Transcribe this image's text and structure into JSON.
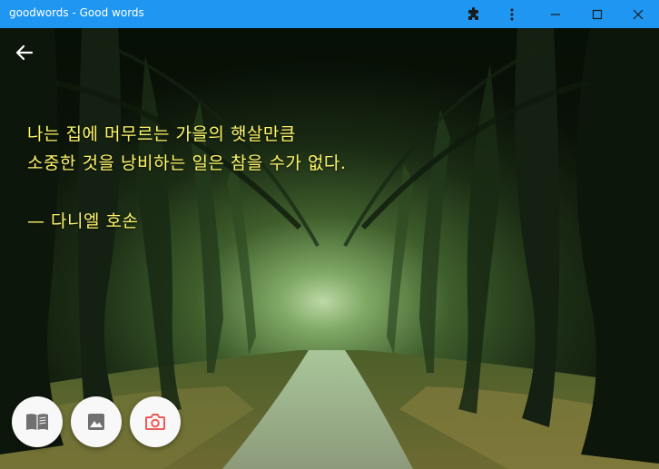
{
  "window": {
    "title": "goodwords - Good words",
    "titlebar_color": "#1f96f2"
  },
  "toolbar": {
    "extensions_icon": "puzzle-icon",
    "menu_icon": "more-vertical-icon",
    "minimize_icon": "minimize-icon",
    "maximize_icon": "maximize-icon",
    "close_icon": "close-icon"
  },
  "main": {
    "back_icon": "arrow-left-icon",
    "quote": {
      "line1": "나는 집에 머무르는 가을의 햇살만큼",
      "line2": "소중한 것을 낭비하는 일은 참을 수가 없다.",
      "author": "— 다니엘 호손",
      "color": "#fff56a"
    },
    "background": "forest-path-image",
    "actions": [
      {
        "icon": "book-icon",
        "color": "#707070"
      },
      {
        "icon": "image-icon",
        "color": "#707070"
      },
      {
        "icon": "camera-icon",
        "color": "#f05a5a"
      }
    ]
  }
}
